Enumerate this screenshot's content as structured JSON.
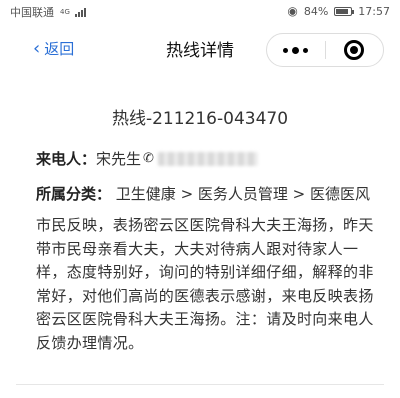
{
  "status_bar": {
    "carrier": "中国联通",
    "network": "4G",
    "battery": "84%",
    "battery_level": 0.84,
    "time": "17:57"
  },
  "nav": {
    "back_label": "返回",
    "title": "热线详情"
  },
  "hotline": {
    "title": "热线-211216-043470",
    "caller_label": "来电人：",
    "caller_name": "宋先生",
    "category_label": "所属分类：",
    "category_value": "卫生健康 > 医务人员管理 > 医德医风",
    "content": "市民反映，表扬密云区医院骨科大夫王海扬，昨天带市民母亲看大夫，大夫对待病人跟对待家人一样，态度特别好，询问的特别详细仔细，解释的非常好，对他们高尚的医德表示感谢，来电反映表扬密云区医院骨科大夫王海扬。注：请及时向来电人反馈办理情况。"
  },
  "icons": {
    "eye": "eye-icon",
    "battery": "battery-icon",
    "back": "chevron-left-icon",
    "more": "more-dots-icon",
    "close": "target-icon",
    "phone": "phone-icon"
  }
}
